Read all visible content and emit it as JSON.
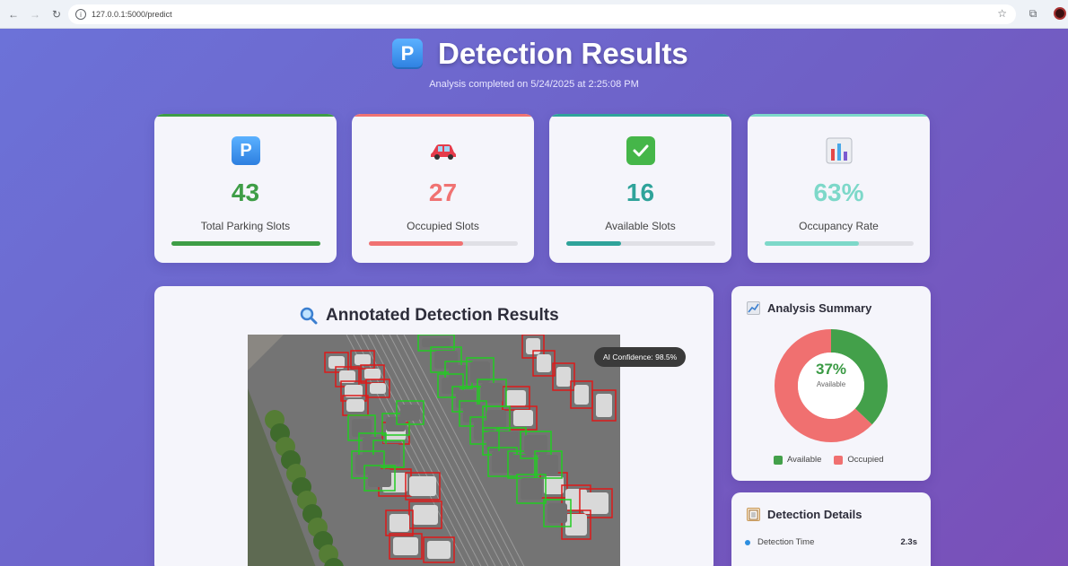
{
  "browser": {
    "url": "127.0.0.1:5000/predict",
    "back_icon": "arrow-left",
    "forward_icon": "arrow-right",
    "reload_icon": "reload",
    "star_icon": "star"
  },
  "header": {
    "title": "Detection Results",
    "subtitle": "Analysis completed on 5/24/2025 at 2:25:08 PM",
    "icon_letter": "P"
  },
  "stats": [
    {
      "value": "43",
      "label": "Total Parking Slots",
      "icon": "parking-icon",
      "color": "#3e9d46",
      "fill": 1.0
    },
    {
      "value": "27",
      "label": "Occupied Slots",
      "icon": "car-icon",
      "color": "#f07272",
      "fill": 0.63
    },
    {
      "value": "16",
      "label": "Available Slots",
      "icon": "check-icon",
      "color": "#2fa39a",
      "fill": 0.37
    },
    {
      "value": "63%",
      "label": "Occupancy Rate",
      "icon": "chart-icon",
      "color": "#7dd8c9",
      "fill": 0.63
    }
  ],
  "annotated": {
    "title": "Annotated Detection Results",
    "confidence": "AI Confidence: 98.5%"
  },
  "summary": {
    "title": "Analysis Summary",
    "percent": "37%",
    "sublabel": "Available",
    "available_fraction": 0.37,
    "legend_available": "Available",
    "legend_occupied": "Occupied",
    "color_available": "#43a04a",
    "color_occupied": "#f07070"
  },
  "details": {
    "title": "Detection Details",
    "rows": [
      {
        "label": "Detection Time",
        "value": "2.3s"
      }
    ]
  }
}
